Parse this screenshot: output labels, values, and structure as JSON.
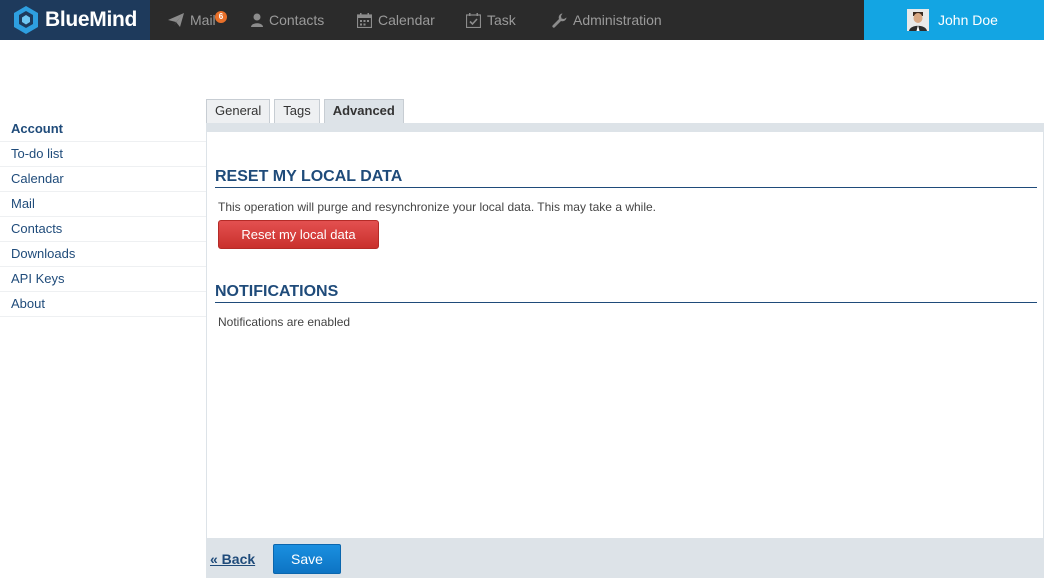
{
  "app": {
    "name": "BlueMind"
  },
  "nav": [
    {
      "label": "Mail",
      "icon": "paper-plane-icon",
      "badge": "6"
    },
    {
      "label": "Contacts",
      "icon": "user-icon"
    },
    {
      "label": "Calendar",
      "icon": "calendar-icon"
    },
    {
      "label": "Task",
      "icon": "task-checkbox-icon"
    },
    {
      "label": "Administration",
      "icon": "wrench-icon"
    }
  ],
  "user": {
    "name": "John Doe"
  },
  "sidebar": {
    "items": [
      {
        "label": "Account",
        "active": true
      },
      {
        "label": "To-do list"
      },
      {
        "label": "Calendar"
      },
      {
        "label": "Mail"
      },
      {
        "label": "Contacts"
      },
      {
        "label": "Downloads"
      },
      {
        "label": "API Keys"
      },
      {
        "label": "About"
      }
    ]
  },
  "tabs": [
    {
      "label": "General"
    },
    {
      "label": "Tags"
    },
    {
      "label": "Advanced",
      "active": true
    }
  ],
  "sections": {
    "reset": {
      "title": "RESET MY LOCAL DATA",
      "description": "This operation will purge and resynchronize your local data. This may take a while.",
      "button_label": "Reset my local data"
    },
    "notifications": {
      "title": "NOTIFICATIONS",
      "status": "Notifications are enabled"
    }
  },
  "footer": {
    "back_label": "« Back",
    "save_label": "Save"
  },
  "colors": {
    "brand": "#1e3a5c",
    "accent": "#13a5e3",
    "danger": "#d9423e",
    "primary": "#0d74c4",
    "heading": "#1f4b7a"
  }
}
